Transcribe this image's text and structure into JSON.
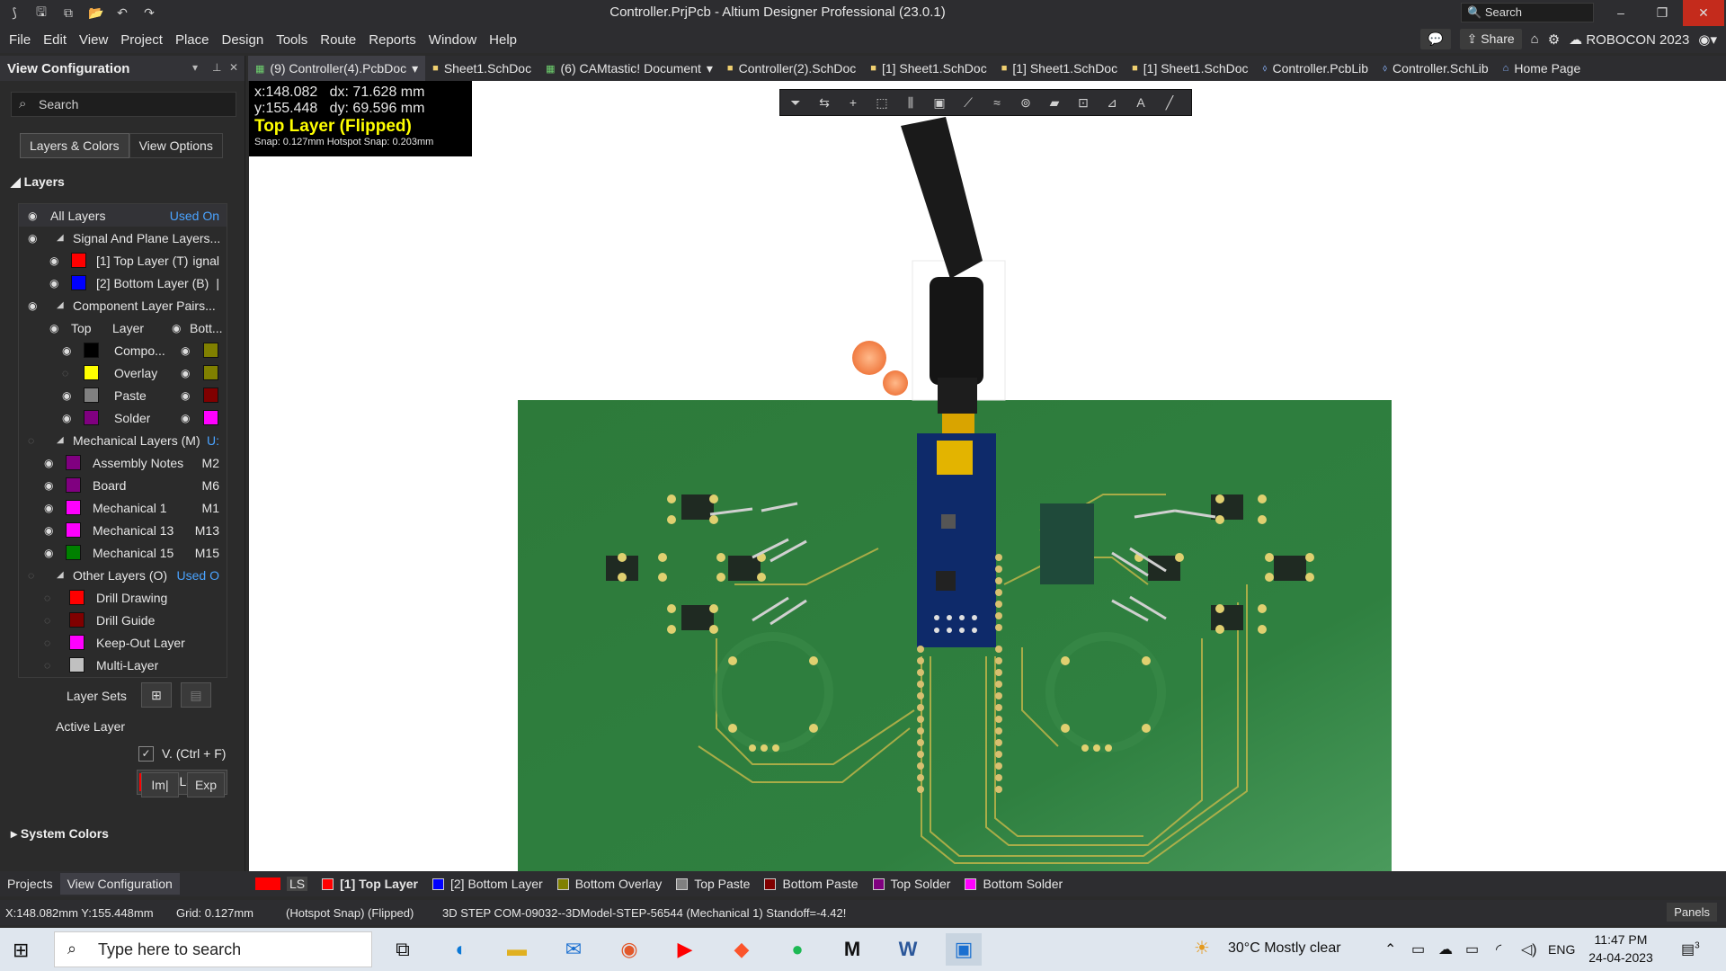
{
  "window": {
    "title": "Controller.PrjPcb - Altium Designer Professional (23.0.1)",
    "search_placeholder": "Search",
    "minimize": "–",
    "maximize": "❐",
    "close": "✕"
  },
  "menu": [
    "File",
    "Edit",
    "View",
    "Project",
    "Place",
    "Design",
    "Tools",
    "Route",
    "Reports",
    "Window",
    "Help"
  ],
  "menu_right": {
    "share": "Share",
    "account": "ROBOCON 2023"
  },
  "left_panel": {
    "title": "View Configuration",
    "search_placeholder": "Search",
    "tabs": [
      "Layers & Colors",
      "View Options"
    ],
    "layers_header": "Layers",
    "rows": {
      "all_layers": {
        "label": "All Layers",
        "right": "Used On"
      },
      "signal_plane": {
        "label": "Signal And Plane Layers..."
      },
      "top_layer": {
        "label": "[1] Top Layer (T)",
        "right": "ignal",
        "color": "#ff0000"
      },
      "bottom_layer": {
        "label": "[2] Bottom Layer (B)",
        "right": "|",
        "color": "#0000ff"
      },
      "component_pairs": {
        "label": "Component Layer Pairs..."
      },
      "pair_header": {
        "left": "Top",
        "mid": "Layer",
        "right": "Bott..."
      },
      "compo": {
        "label": "Compo...",
        "top_color": "#000000",
        "bottom_color": "#808000"
      },
      "overlay": {
        "label": "Overlay",
        "top_color": "#ffff00",
        "bottom_color": "#808000"
      },
      "paste": {
        "label": "Paste",
        "top_color": "#808080",
        "bottom_color": "#800000"
      },
      "solder": {
        "label": "Solder",
        "top_color": "#800080",
        "bottom_color": "#ff00ff"
      },
      "mechanical": {
        "label": "Mechanical Layers (M)",
        "right": "U:"
      },
      "assembly_notes": {
        "label": "Assembly Notes",
        "right": "M2",
        "color": "#800080"
      },
      "board": {
        "label": "Board",
        "right": "M6",
        "color": "#800080"
      },
      "mech1": {
        "label": "Mechanical 1",
        "right": "M1",
        "color": "#ff00ff"
      },
      "mech13": {
        "label": "Mechanical 13",
        "right": "M13",
        "color": "#ff00ff"
      },
      "mech15": {
        "label": "Mechanical 15",
        "right": "M15",
        "color": "#008000"
      },
      "other": {
        "label": "Other Layers (O)",
        "right": "Used O"
      },
      "drill_drawing": {
        "label": "Drill Drawing",
        "color": "#ff0000"
      },
      "drill_guide": {
        "label": "Drill Guide",
        "color": "#800000"
      },
      "keepout": {
        "label": "Keep-Out Layer",
        "color": "#ff00ff"
      },
      "multi": {
        "label": "Multi-Layer",
        "color": "#c0c0c0"
      }
    },
    "layer_sets_label": "Layer Sets",
    "active_layer_label": "Active Layer",
    "active_layer_value": "Top Layer",
    "active_layer_color": "#ff0000",
    "v_label": "V. (Ctrl + F)",
    "import_label": "Im|",
    "export_label": "Exp",
    "system_colors": "System Colors"
  },
  "doc_tabs": [
    "(9) Controller(4).PcbDoc",
    "Sheet1.SchDoc",
    "(6) CAMtastic! Document",
    "Controller(2).SchDoc",
    "[1] Sheet1.SchDoc",
    "[1] Sheet1.SchDoc",
    "[1] Sheet1.SchDoc",
    "Controller.PcbLib",
    "Controller.SchLib",
    "Home Page"
  ],
  "coords": {
    "x": "x:148.082",
    "dx": "dx: 71.628 mm",
    "y": "y:155.448",
    "dy": "dy: 69.596 mm",
    "layer": "Top Layer (Flipped)",
    "snap": "Snap: 0.127mm Hotspot Snap: 0.203mm"
  },
  "panel_tabs": [
    "Projects",
    "View Configuration"
  ],
  "layer_strip": [
    {
      "label": "LS",
      "color": "#ff0000"
    },
    {
      "label": "[1] Top Layer",
      "color": "#ff0000"
    },
    {
      "label": "[2] Bottom Layer",
      "color": "#0000ff"
    },
    {
      "label": "Bottom Overlay",
      "color": "#808000"
    },
    {
      "label": "Top Paste",
      "color": "#808080"
    },
    {
      "label": "Bottom Paste",
      "color": "#800000"
    },
    {
      "label": "Top Solder",
      "color": "#800080"
    },
    {
      "label": "Bottom Solder",
      "color": "#ff00ff"
    }
  ],
  "status": {
    "coords": "X:148.082mm Y:155.448mm",
    "grid": "Grid: 0.127mm",
    "snap": "(Hotspot Snap) (Flipped)",
    "info": "3D STEP COM-09032--3DModel-STEP-56544 (Mechanical 1)  Standoff=-4.42!",
    "panels": "Panels"
  },
  "taskbar": {
    "search_placeholder": "Type here to search",
    "weather": "30°C  Mostly clear",
    "lang": "ENG",
    "time": "11:47 PM",
    "date": "24-04-2023",
    "notifications": "3"
  }
}
